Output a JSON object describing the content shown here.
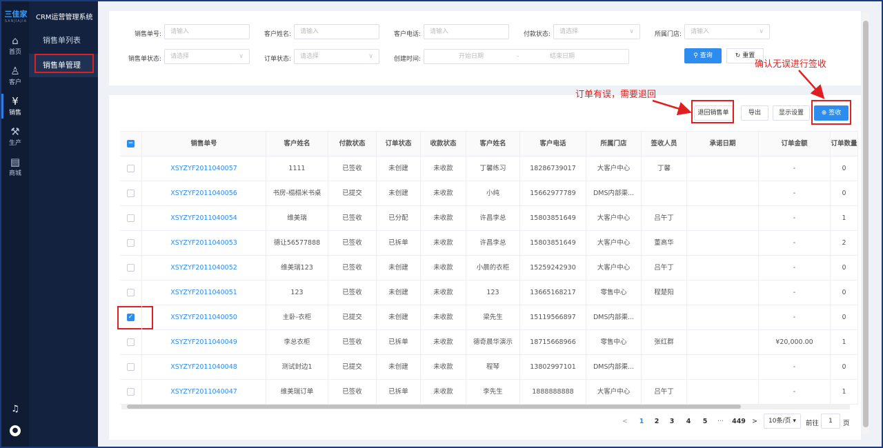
{
  "rail": {
    "logo": "三佳家",
    "logo_sub": "SANJIAJIA",
    "items": [
      {
        "label": "首页",
        "icon": "⌂"
      },
      {
        "label": "客户",
        "icon": "♙"
      },
      {
        "label": "销售",
        "icon": "¥"
      },
      {
        "label": "生产",
        "icon": "⚒"
      },
      {
        "label": "商城",
        "icon": "▤"
      }
    ],
    "bell_icon": "♫",
    "avatar_icon": "●"
  },
  "sidenav": {
    "title": "CRM运营管理系统",
    "items": [
      {
        "label": "销售单列表"
      },
      {
        "label": "销售单管理"
      }
    ]
  },
  "filters": {
    "order_no_label": "销售单号:",
    "order_no_placeholder": "请输入",
    "customer_name_label": "客户姓名:",
    "customer_name_placeholder": "请输入",
    "customer_phone_label": "客户电话:",
    "customer_phone_placeholder": "请输入",
    "pay_status_label": "付款状态:",
    "pay_status_placeholder": "请选择",
    "store_label": "所属门店:",
    "store_placeholder": "请输入",
    "sale_status_label": "销售单状态:",
    "sale_status_placeholder": "请选择",
    "order_status_label": "订单状态:",
    "order_status_placeholder": "请选择",
    "created_label": "创建时间:",
    "start_placeholder": "开始日期",
    "range_sep": "-",
    "end_placeholder": "结束日期",
    "query_label": "查询",
    "reset_label": "重置"
  },
  "toolbar": {
    "return_label": "退回销售单",
    "export_label": "导出",
    "display_label": "显示设置",
    "sign_label": "签收"
  },
  "annotations": {
    "sign_note": "确认无误进行签收",
    "return_note": "订单有误，需要退回"
  },
  "table": {
    "headers": [
      "销售单号",
      "客户姓名",
      "付款状态",
      "订单状态",
      "收款状态",
      "客户姓名",
      "客户电话",
      "所属门店",
      "签收人员",
      "承诺日期",
      "订单金额",
      "订单数量"
    ],
    "rows": [
      {
        "checked": false,
        "cells": [
          "XSYZYF2011040057",
          "1111",
          "已签收",
          "未创建",
          "未收款",
          "丁馨练习",
          "18286739017",
          "大客户中心",
          "丁馨",
          "",
          "-",
          "0"
        ]
      },
      {
        "checked": false,
        "cells": [
          "XSYZYF2011040056",
          "书房-榻榻米书桌",
          "已提交",
          "未创建",
          "未收款",
          "小纯",
          "15662977789",
          "DMS内部渠...",
          "",
          "",
          "-",
          "0"
        ]
      },
      {
        "checked": false,
        "cells": [
          "XSYZYF2011040054",
          "维美瑞",
          "已签收",
          "已分配",
          "未收款",
          "许昌李总",
          "15803851649",
          "大客户中心",
          "吕午丁",
          "",
          "-",
          "1"
        ]
      },
      {
        "checked": false,
        "cells": [
          "XSYZYF2011040053",
          "德让56577888",
          "已签收",
          "已拆单",
          "未收款",
          "许昌李总",
          "15803851649",
          "大客户中心",
          "董高华",
          "",
          "-",
          "2"
        ]
      },
      {
        "checked": false,
        "cells": [
          "XSYZYF2011040052",
          "维美瑞123",
          "已签收",
          "未创建",
          "未收款",
          "小晨的衣柜",
          "15259242930",
          "大客户中心",
          "吕午丁",
          "",
          "-",
          "0"
        ]
      },
      {
        "checked": false,
        "cells": [
          "XSYZYF2011040051",
          "123",
          "已签收",
          "未创建",
          "未收款",
          "123",
          "13665168217",
          "零售中心",
          "程楚阳",
          "",
          "-",
          "0"
        ]
      },
      {
        "checked": true,
        "cells": [
          "XSYZYF2011040050",
          "主卧-衣柜",
          "已提交",
          "未创建",
          "未收款",
          "梁先生",
          "15119566897",
          "DMS内部渠...",
          "",
          "",
          "-",
          "0"
        ]
      },
      {
        "checked": false,
        "cells": [
          "XSYZYF2011040049",
          "李总衣柜",
          "已签收",
          "已拆单",
          "未收款",
          "德奇晨华演示",
          "18715668966",
          "零售中心",
          "张红群",
          "",
          "¥20,000.00",
          "1"
        ]
      },
      {
        "checked": false,
        "cells": [
          "XSYZYF2011040048",
          "测试封边1",
          "已提交",
          "未创建",
          "未收款",
          "程琴",
          "13802997101",
          "DMS内部渠...",
          "",
          "",
          "-",
          "0"
        ]
      },
      {
        "checked": false,
        "cells": [
          "XSYZYF2011040047",
          "维美瑞订单",
          "已签收",
          "已拆单",
          "未收款",
          "李先生",
          "1888888888",
          "大客户中心",
          "吕午丁",
          "",
          "-",
          "1"
        ]
      }
    ]
  },
  "pagination": {
    "prev": "<",
    "pages": [
      "1",
      "2",
      "3",
      "4",
      "5"
    ],
    "ellipsis": "···",
    "last": "449",
    "next": ">",
    "page_size": "10条/页",
    "goto_label": "前往",
    "goto_value": "1",
    "page_unit": "页"
  },
  "colors": {
    "accent": "#2d8cf0",
    "annotation": "#e02020",
    "rail": "#0f1c33"
  }
}
